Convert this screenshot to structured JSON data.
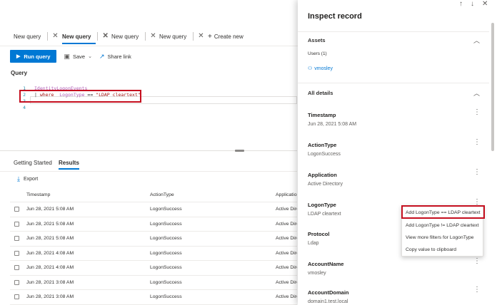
{
  "query_tabs": [
    {
      "label": "New query"
    },
    {
      "label": "New query"
    },
    {
      "label": "New query"
    },
    {
      "label": "New query"
    }
  ],
  "create_new": "Create new",
  "toolbar": {
    "run_label": "Run query",
    "save_label": "Save",
    "share_label": "Share link"
  },
  "query": {
    "label": "Query",
    "line_numbers": [
      "1",
      "2",
      "3",
      "4"
    ],
    "line1": "IdentityLogonEvents",
    "line2_pipe": "|",
    "line2_kw": "where",
    "line2_field": "LogonType",
    "line2_op": "==",
    "line2_value": "\"LDAP cleartext\""
  },
  "result_tabs": {
    "getting_started": "Getting Started",
    "results": "Results"
  },
  "export_label": "Export",
  "grid": {
    "headers": {
      "timestamp": "Timestamp",
      "action": "ActionType",
      "app": "Application"
    },
    "rows": [
      {
        "ts": "Jun 28, 2021 5:08 AM",
        "action": "LogonSuccess",
        "app": "Active Direct"
      },
      {
        "ts": "Jun 28, 2021 5:08 AM",
        "action": "LogonSuccess",
        "app": "Active Direct"
      },
      {
        "ts": "Jun 28, 2021 5:08 AM",
        "action": "LogonSuccess",
        "app": "Active Direct"
      },
      {
        "ts": "Jun 28, 2021 4:08 AM",
        "action": "LogonSuccess",
        "app": "Active Direct"
      },
      {
        "ts": "Jun 28, 2021 4:08 AM",
        "action": "LogonSuccess",
        "app": "Active Direct"
      },
      {
        "ts": "Jun 28, 2021 3:08 AM",
        "action": "LogonSuccess",
        "app": "Active Direct"
      },
      {
        "ts": "Jun 28, 2021 3:08 AM",
        "action": "LogonSuccess",
        "app": "Active Direct"
      },
      {
        "ts": "Jun 28, 2021 3:08 AM",
        "action": "LogonSuccess",
        "app": "Active Direct"
      }
    ]
  },
  "panel": {
    "title": "Inspect record",
    "assets_label": "Assets",
    "users_label": "Users (1)",
    "user_name": "vmosley",
    "all_details_label": "All details",
    "details": [
      {
        "key": "Timestamp",
        "value": "Jun 28, 2021 5:08 AM"
      },
      {
        "key": "ActionType",
        "value": "LogonSuccess"
      },
      {
        "key": "Application",
        "value": "Active Directory"
      },
      {
        "key": "LogonType",
        "value": "LDAP cleartext"
      },
      {
        "key": "Protocol",
        "value": "Ldap"
      },
      {
        "key": "AccountName",
        "value": "vmosley"
      },
      {
        "key": "AccountDomain",
        "value": "domain1.test.local"
      }
    ]
  },
  "context_menu": [
    "Add LogonType == LDAP cleartext",
    "Add LogonType != LDAP cleartext",
    "View more filters for LogonType",
    "Copy value to clipboard"
  ],
  "colors": {
    "accent": "#0078d4",
    "highlight": "#c50f1f"
  }
}
